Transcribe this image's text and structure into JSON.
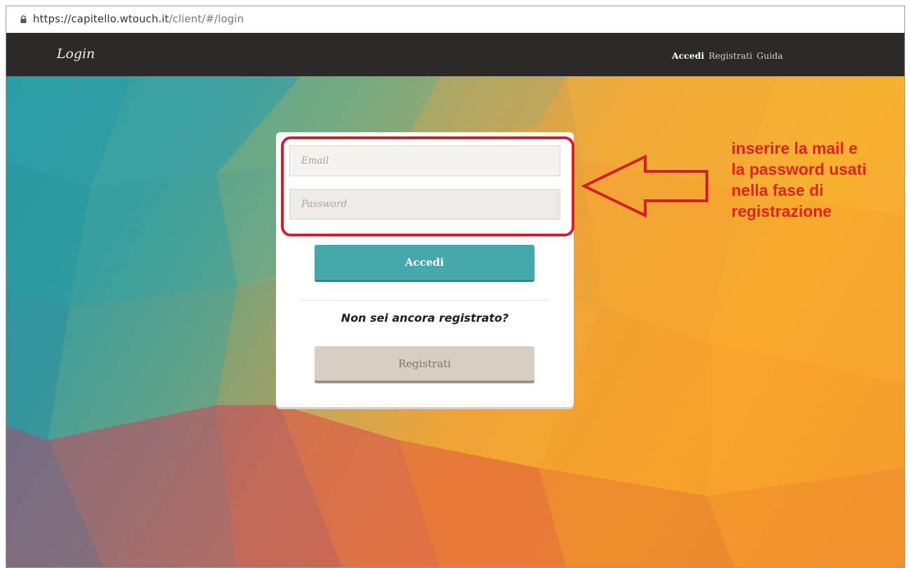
{
  "browser": {
    "url_host": "https://capitello.wtouch.it",
    "url_path": "/client/#/login"
  },
  "navbar": {
    "brand": "Login",
    "links": [
      {
        "label": "Accedi",
        "active": true
      },
      {
        "label": "Registrati",
        "active": false
      },
      {
        "label": "Guida",
        "active": false
      }
    ]
  },
  "form": {
    "email_placeholder": "Email",
    "password_placeholder": "Password",
    "submit_label": "Accedi",
    "question": "Non sei ancora registrato?",
    "register_label": "Registrati"
  },
  "annotation": {
    "lines": [
      "inserire la mail e",
      "la password usati",
      "nella fase di",
      "registrazione"
    ],
    "color": "#e2221f"
  },
  "colors": {
    "navbar": "#2b2a29",
    "accent_teal": "#45a8ab",
    "register_button": "#d8cec4"
  }
}
